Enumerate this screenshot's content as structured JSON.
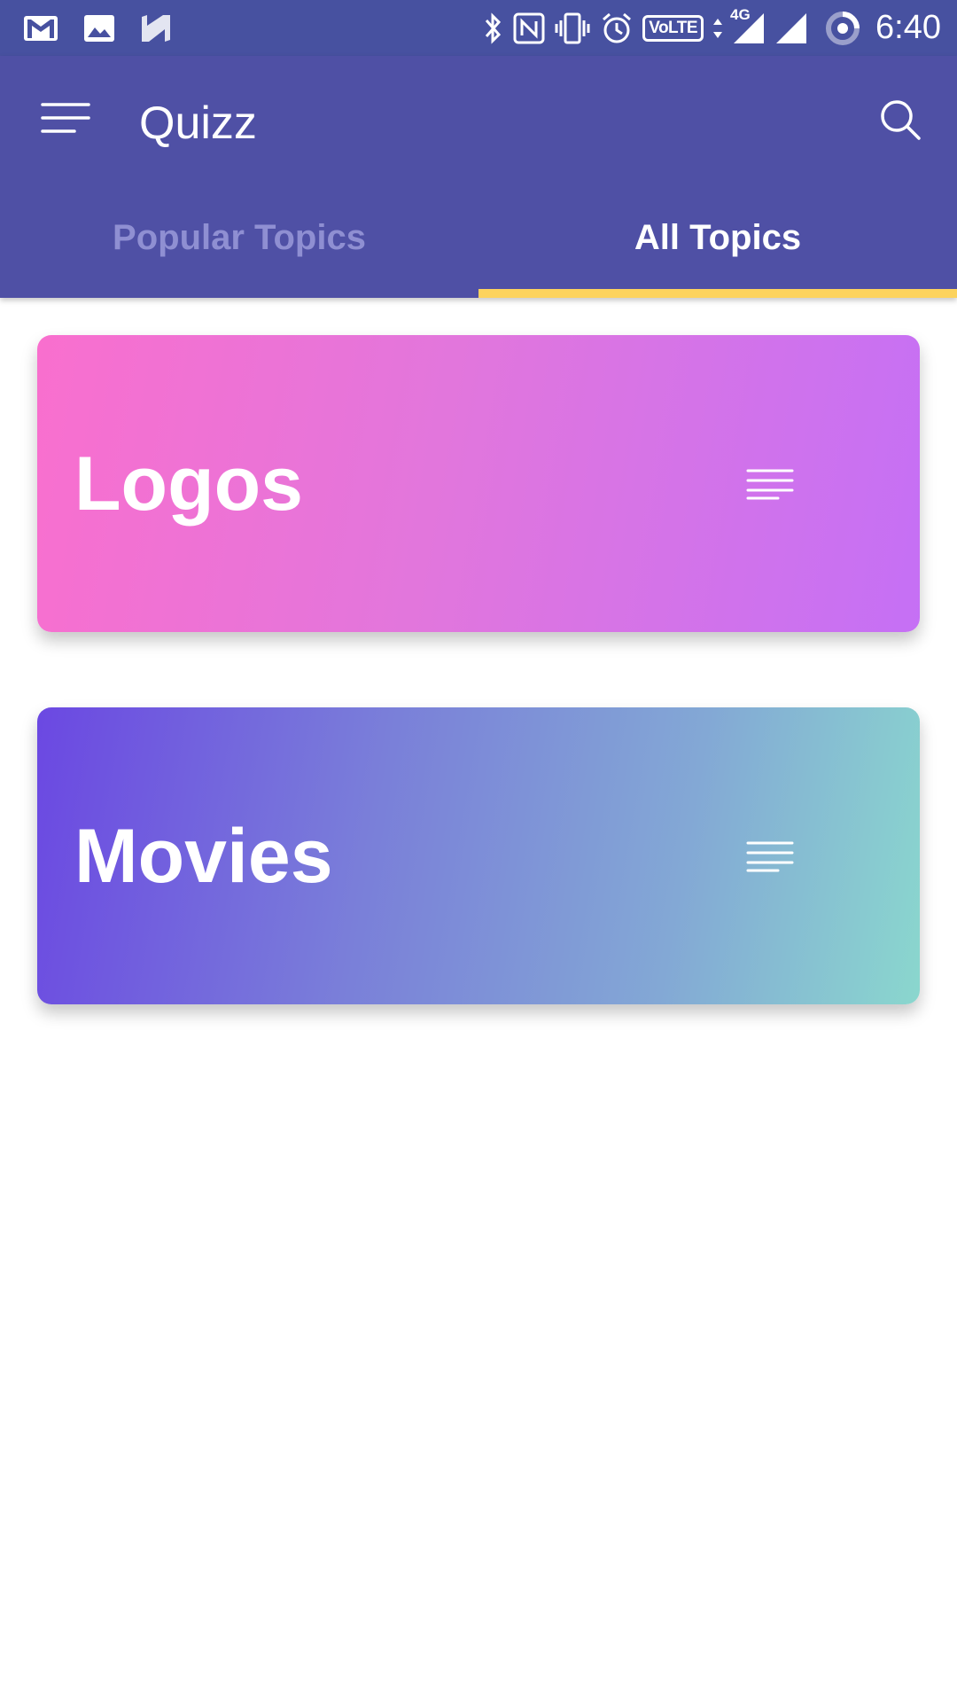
{
  "status_bar": {
    "time": "6:40",
    "network": "4G",
    "volte": "VoLTE",
    "icons_left": [
      "gmail-icon",
      "image-icon",
      "n-logo-icon"
    ],
    "icons_right": [
      "bluetooth-icon",
      "nfc-icon",
      "vibrate-icon",
      "alarm-icon",
      "volte-icon",
      "data-arrows-icon",
      "signal-icon",
      "signal-icon",
      "battery-ring-icon"
    ]
  },
  "app_bar": {
    "title": "Quizz",
    "menu_icon": "hamburger-menu-icon",
    "search_icon": "search-icon"
  },
  "tabs": [
    {
      "label": "Popular Topics",
      "active": false
    },
    {
      "label": "All Topics",
      "active": true
    }
  ],
  "topics": [
    {
      "title": "Logos",
      "icon": "lines-menu-icon"
    },
    {
      "title": "Movies",
      "icon": "lines-menu-icon"
    }
  ],
  "colors": {
    "status_bar": "#4751a0",
    "app_bar": "#4f50a5",
    "tab_indicator": "#fcd35e",
    "inactive_tab": "#8f8fd2",
    "logos_gradient": [
      "#f96fce",
      "#c570f5"
    ],
    "movies_gradient": [
      "#6b48e2",
      "#8ad7ce"
    ]
  }
}
